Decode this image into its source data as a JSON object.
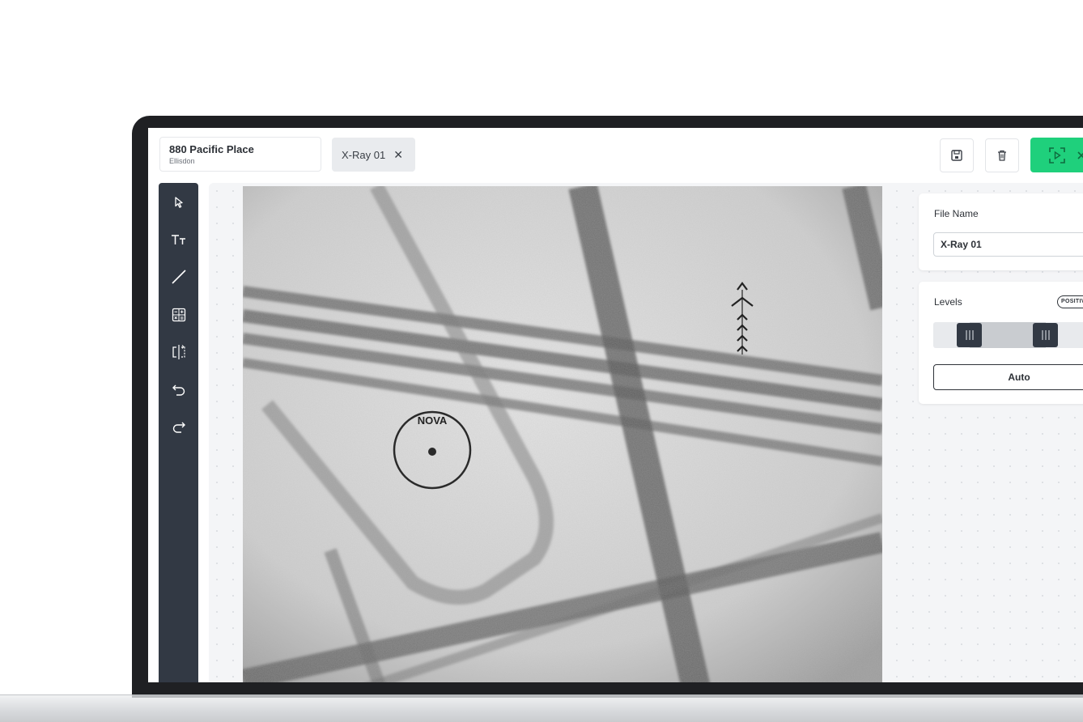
{
  "project": {
    "title": "880 Pacific Place",
    "subtitle": "Ellisdon"
  },
  "tab": {
    "label": "X-Ray 01",
    "close_glyph": "✕"
  },
  "toolbar": {
    "save_icon": "save-icon",
    "delete_icon": "trash-icon",
    "analyze_icon": "scan-icon",
    "accent_color": "#1fd07c"
  },
  "tools": [
    {
      "name": "select-tool",
      "icon": "cursor-arrow-icon"
    },
    {
      "name": "text-tool",
      "icon": "text-size-icon"
    },
    {
      "name": "line-tool",
      "icon": "line-icon"
    },
    {
      "name": "calculator-tool",
      "icon": "calculator-icon"
    },
    {
      "name": "flip-tool",
      "icon": "flip-horizontal-icon"
    },
    {
      "name": "undo-tool",
      "icon": "undo-icon"
    },
    {
      "name": "redo-tool",
      "icon": "redo-icon"
    }
  ],
  "image": {
    "marker_text": "NOVA"
  },
  "file_panel": {
    "label": "File Name",
    "value": "X-Ray 01"
  },
  "levels_panel": {
    "label": "Levels",
    "badge": "POSITIVE",
    "low": 0.21,
    "high": 0.66,
    "auto_label": "Auto"
  }
}
